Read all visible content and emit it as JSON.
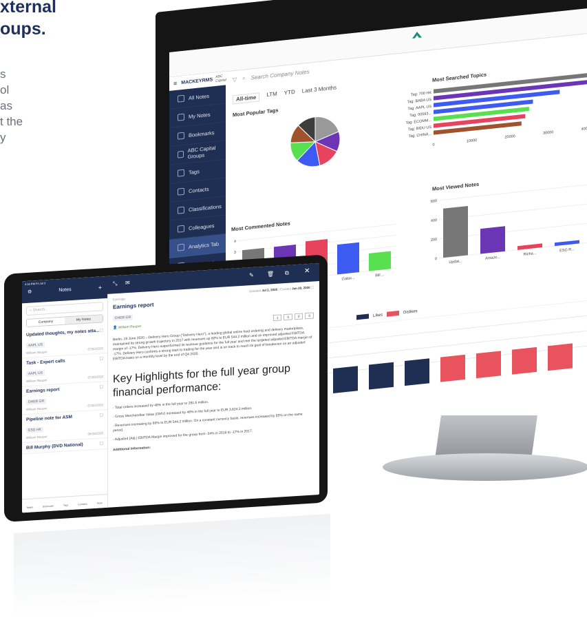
{
  "hero": {
    "title_lines": "xternal\noups.",
    "body_lines": "s\nol\nas\nt the\ny"
  },
  "monitor": {
    "brand": "MACKEYRMS",
    "client": "ABC Capital",
    "search_placeholder": "Search Company Notes",
    "sidebar": [
      {
        "label": "All Notes",
        "icon": "notes-icon"
      },
      {
        "label": "My Notes",
        "icon": "my-notes-icon"
      },
      {
        "label": "Bookmarks",
        "icon": "star-icon"
      },
      {
        "label": "ABC Capital Groups",
        "icon": "group-icon"
      },
      {
        "label": "Tags",
        "icon": "tag-icon"
      },
      {
        "label": "Contacts",
        "icon": "contacts-icon"
      },
      {
        "label": "Classifications",
        "icon": "classification-icon"
      },
      {
        "label": "Colleagues",
        "icon": "colleagues-icon"
      },
      {
        "label": "Analytics Tab",
        "icon": "analytics-icon"
      },
      {
        "label": "Dashboards",
        "icon": "dashboard-icon"
      }
    ],
    "tabs": [
      "All-time",
      "LTM",
      "YTD",
      "Last 3 Months"
    ],
    "popular_tags_title": "Most Popular Tags",
    "searched_topics_title": "Most Searched Topics",
    "commented_notes_title": "Most Commented Notes",
    "viewed_notes_title": "Most Viewed Notes",
    "legend": [
      "Likes",
      "Dislikes"
    ]
  },
  "chart_data": [
    {
      "type": "pie",
      "title": "Most Popular Tags",
      "values": [
        20,
        13,
        14,
        16,
        13,
        12,
        12
      ],
      "colors": [
        "#999999",
        "#6b35b5",
        "#e8435e",
        "#3d5af1",
        "#58e050",
        "#a0522d",
        "#3d3d3d"
      ]
    },
    {
      "type": "bar",
      "title": "Most Searched Topics",
      "orientation": "horizontal",
      "categories": [
        "Tag: 700 HK",
        "Tag: BABA US",
        "Tag: AAPL US",
        "Tag: 00593...",
        "Tag: ECOMM...",
        "Tag: BIDU US",
        "Tag: CHINA..."
      ],
      "values": [
        45000,
        41000,
        33000,
        26000,
        25000,
        24000,
        23000
      ],
      "xticks": [
        "0",
        "10000",
        "20000",
        "30000",
        "40000"
      ],
      "colors": [
        "#777777",
        "#6b35b5",
        "#3d5af1",
        "#3d5af1",
        "#58e050",
        "#e8435e",
        "#a0522d"
      ]
    },
    {
      "type": "bar",
      "title": "Most Commented Notes",
      "categories": [
        "",
        "",
        "",
        "Galax...",
        "Bill ..."
      ],
      "values": [
        3.1,
        3.1,
        3.3,
        2.7,
        1.6
      ],
      "yticks": [
        "0",
        "1",
        "2",
        "3",
        "4"
      ],
      "ylim": [
        0,
        4
      ],
      "colors": [
        "#777777",
        "#6b35b5",
        "#e8435e",
        "#3d5af1",
        "#58e050"
      ]
    },
    {
      "type": "bar",
      "title": "Most Viewed Notes",
      "categories": [
        "Updat...",
        "Amazo...",
        "Richa...",
        "ESG R..."
      ],
      "values": [
        510,
        260,
        40,
        35
      ],
      "yticks": [
        "0",
        "200",
        "400",
        "600"
      ],
      "ylim": [
        0,
        600
      ],
      "colors": [
        "#777777",
        "#6b35b5",
        "#e8435e",
        "#3d5af1"
      ]
    },
    {
      "type": "bar",
      "title": "",
      "series": [
        {
          "name": "Likes",
          "color": "#1f2f54",
          "values": [
            1,
            1,
            1,
            1,
            0,
            0,
            0,
            0
          ]
        },
        {
          "name": "Dislikes",
          "color": "#e8535e",
          "values": [
            0,
            0,
            0,
            0,
            1,
            1,
            1,
            1
          ]
        }
      ]
    }
  ],
  "tablet": {
    "status_time": "4:16 PM  Fri Jul 3",
    "battery": "100%",
    "notes_header": "Notes",
    "search_placeholder": "Search...",
    "segments": [
      "Company",
      "My Notes"
    ],
    "notes": [
      {
        "title": "Updated thoughts, my notes atta...",
        "tag": "AAPL US",
        "author": "William Reuper",
        "date": "07/02/2020"
      },
      {
        "title": "Task - Expert calls",
        "tag": "AAPL US",
        "author": "William Reuper",
        "date": "07/02/2020"
      },
      {
        "title": "Earnings report",
        "tag": "DHER GR",
        "author": "William Reuper",
        "date": "07/02/2020"
      },
      {
        "title": "Pipeline note for ASM",
        "tag": "ESG HK",
        "author": "William Reuper",
        "date": "06/26/2020"
      },
      {
        "title": "Bill Murphy (DVD National)",
        "tag": "",
        "author": "",
        "date": ""
      }
    ],
    "tabbar": [
      "Notes",
      "Bookmark",
      "Tags",
      "Contacts",
      "More"
    ],
    "detail": {
      "category": "Earnings",
      "updated_label": "Updated",
      "updated": "Jul 2, 2020",
      "created_label": "Created",
      "created": "Jan 20, 2020",
      "title": "Earnings report",
      "tag": "DHER GR",
      "author": "William Reuper",
      "counts": [
        "1",
        "0",
        "0",
        "0"
      ],
      "paragraph": "Berlin, 19 June 2020 – Delivery Hero Group (\"Delivery Hero\"), a leading global online food ordering and delivery marketplace, maintained its strong growth trajectory in 2017 with revenues up 60% to EUR 544.2 million and an improved adjusted EBITDA margin of -17%. Delivery Hero outperformed its revenue guidance for the full year and met the targeted adjusted EBITDA margin of -17%. Delivery Hero confirms a strong start to trading for the year and is on track to reach its goal of breakeven on an adjusted EBITDA basis on a monthly level by the end of Q4 2020.",
      "heading": "Key Highlights for the full year group financial performance:",
      "bullets": [
        "- Total orders increased by 48% in the full year to 291.6 million.",
        "- Gross Merchandise Value (GMV) increased by 46% in the full year to EUR 3,824.3 million.",
        "- Revenues increasing by 60% to EUR 544.2 million. On a constant currency basis, revenues increased by 65% on the same period.",
        "- Adjusted (Adj.) EBITDA Margin improved for the group from -34% in 2016 to -17% in 2017."
      ],
      "additional": "Additional Information:"
    }
  }
}
